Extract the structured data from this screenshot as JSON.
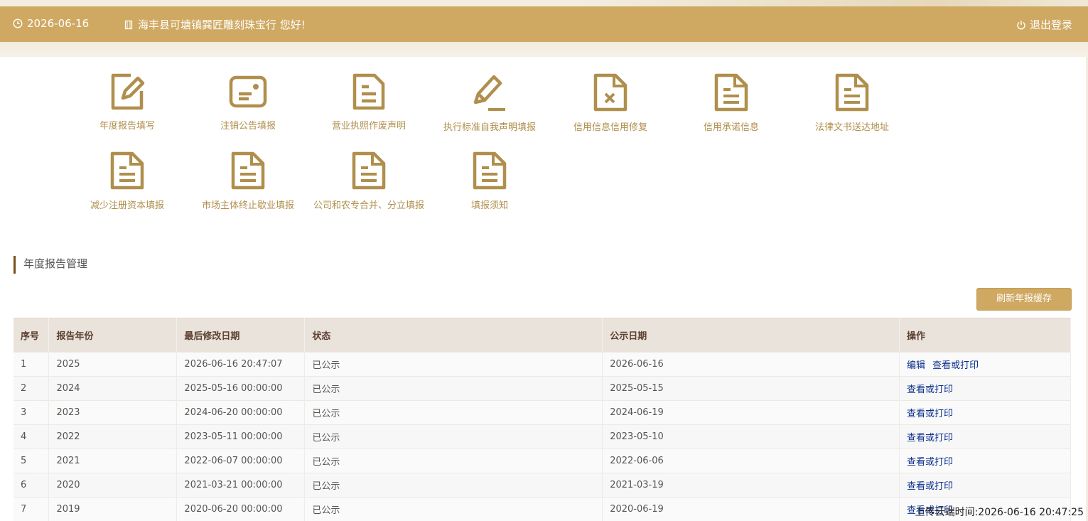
{
  "header": {
    "date": "2026-06-16",
    "company_greeting": "海丰县可塘镇巽匠雕刻珠宝行 您好!",
    "logout": "退出登录",
    "bg_color": "#cfa862"
  },
  "shortcuts": [
    {
      "label": "年度报告填写",
      "icon": "edit-icon"
    },
    {
      "label": "注销公告填报",
      "icon": "card-icon"
    },
    {
      "label": "营业执照作废声明",
      "icon": "document-icon"
    },
    {
      "label": "执行标准自我声明填报",
      "icon": "pencil-icon"
    },
    {
      "label": "信用信息信用修复",
      "icon": "document-x-icon"
    },
    {
      "label": "信用承诺信息",
      "icon": "document-icon"
    },
    {
      "label": "法律文书送达地址",
      "icon": "document-icon"
    },
    {
      "label": "减少注册资本填报",
      "icon": "document-icon"
    },
    {
      "label": "市场主体终止歇业填报",
      "icon": "document-icon"
    },
    {
      "label": "公司和农专合并、分立填报",
      "icon": "document-icon"
    },
    {
      "label": "填报须知",
      "icon": "document-icon"
    }
  ],
  "section": {
    "title": "年度报告管理",
    "refresh_button": "刷新年报缓存"
  },
  "table": {
    "columns": [
      "序号",
      "报告年份",
      "最后修改日期",
      "状态",
      "公示日期",
      "操作"
    ],
    "rows": [
      {
        "no": "1",
        "year": "2025",
        "modified": "2026-06-16 20:47:07",
        "status": "已公示",
        "published": "2026-06-16",
        "actions": [
          "编辑",
          "查看或打印"
        ]
      },
      {
        "no": "2",
        "year": "2024",
        "modified": "2025-05-16 00:00:00",
        "status": "已公示",
        "published": "2025-05-15",
        "actions": [
          "查看或打印"
        ]
      },
      {
        "no": "3",
        "year": "2023",
        "modified": "2024-06-20 00:00:00",
        "status": "已公示",
        "published": "2024-06-19",
        "actions": [
          "查看或打印"
        ]
      },
      {
        "no": "4",
        "year": "2022",
        "modified": "2023-05-11 00:00:00",
        "status": "已公示",
        "published": "2023-05-10",
        "actions": [
          "查看或打印"
        ]
      },
      {
        "no": "5",
        "year": "2021",
        "modified": "2022-06-07 00:00:00",
        "status": "已公示",
        "published": "2022-06-06",
        "actions": [
          "查看或打印"
        ]
      },
      {
        "no": "6",
        "year": "2020",
        "modified": "2021-03-21 00:00:00",
        "status": "已公示",
        "published": "2021-03-19",
        "actions": [
          "查看或打印"
        ]
      },
      {
        "no": "7",
        "year": "2019",
        "modified": "2020-06-20 00:00:00",
        "status": "已公示",
        "published": "2020-06-19",
        "actions": [
          "查看或打印"
        ]
      }
    ]
  },
  "footer": {
    "upload_time": "上传云端时间:2026-06-16 20:47:25"
  },
  "colors": {
    "accent": "#cfa862",
    "icon": "#b08f4c",
    "link": "#0b2f8c",
    "section_bar": "#7a4d1a"
  }
}
